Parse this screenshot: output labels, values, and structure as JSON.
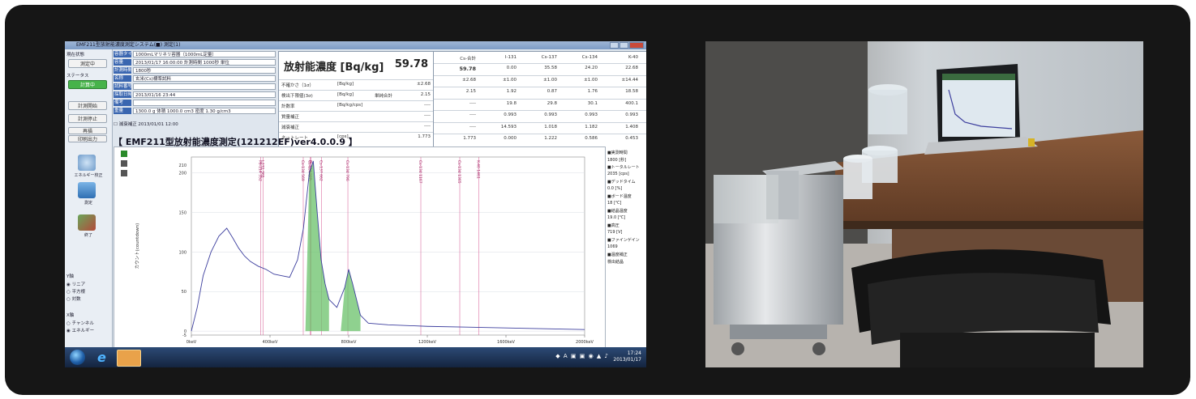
{
  "window": {
    "title": "EMF211型放射能濃度測定システム(■) 測定(1)"
  },
  "left_panel": {
    "status_label": "現在状態",
    "state_button": "測定中",
    "status_text": "ステータス",
    "mode_button": "計算中",
    "start_button": "計測開始",
    "stop_button": "計測停止",
    "display_button": "再描",
    "save_button": "印刷出力",
    "energy_calib_label": "エネルギー校正",
    "measure_label": "測定",
    "exit_label": "終了",
    "scale_title": "Y軸",
    "scale_options": [
      "リニア",
      "平方根",
      "対数"
    ],
    "scale_selected": "リニア",
    "xaxis_title": "X軸",
    "xaxis_options": [
      "チャンネル",
      "エネルギー"
    ],
    "xaxis_selected": "エネルギー"
  },
  "form": {
    "rows": [
      {
        "k": "容器タイプ",
        "v": "1000mLマリネリ容器（1000mL定量）"
      },
      {
        "k": "容量",
        "v": "2013/01/17 16:00:00 計測時間 1000秒 単位"
      },
      {
        "k": "計測時間",
        "v": "1800秒"
      },
      {
        "k": "名称",
        "v": "玄米(Cs)標準試料"
      },
      {
        "k": "試料番号",
        "v": ""
      },
      {
        "k": "採取日時",
        "v": "2013/01/16 23:44"
      },
      {
        "k": "備考",
        "v": ""
      },
      {
        "k": "重量",
        "v": "1300.0 g 体積 1000.0 cm3 密度 1.30 g/cm3"
      }
    ],
    "checkbox_label": "減衰補正 2013/01/01 12:00"
  },
  "result": {
    "title": "放射能濃度  [Bq/kg]",
    "value": "59.78",
    "rows": [
      {
        "label": "不確かさ（1σ）",
        "unit": "[Bq/kg]",
        "val": "±2.68"
      },
      {
        "label": "検出下限値(3σ)",
        "unit": "[Bq/kg]",
        "extra": "単純合計",
        "val": "2.15"
      },
      {
        "label": "計数率",
        "unit": "[Bq/kg/cps]",
        "val": "----"
      },
      {
        "label": "質量補正",
        "unit": "",
        "val": "----"
      },
      {
        "label": "減衰補正",
        "unit": "",
        "val": "----"
      },
      {
        "label": "ネットレート",
        "unit": "[cps]",
        "val": "1.773"
      }
    ]
  },
  "grid": {
    "headers": [
      "Cs-合計",
      "I-131",
      "Cs-137",
      "Cs-134",
      "K-40"
    ],
    "rows": [
      [
        "59.78",
        "0.00",
        "35.58",
        "24.20",
        "22.68"
      ],
      [
        "±2.68",
        "±1.00",
        "±1.00",
        "±1.00",
        "±14.44"
      ],
      [
        "2.15",
        "1.92",
        "0.87",
        "1.76",
        "18.58"
      ],
      [
        "----",
        "19.8",
        "29.8",
        "30.1",
        "400.1"
      ],
      [
        "----",
        "0.993",
        "0.993",
        "0.993",
        "0.993"
      ],
      [
        "----",
        "14.593",
        "1.018",
        "1.182",
        "1.408"
      ],
      [
        "1.773",
        "0.000",
        "1.222",
        "0.586",
        "0.453"
      ]
    ]
  },
  "chart_header": "【 EMF211型放射能濃度測定(121212EF)ver4.0.0.9 】",
  "chart_data": {
    "type": "line",
    "title": "",
    "xlabel": "エネルギー",
    "ylabel": "カウント(countdown)",
    "xlim": [
      0,
      2000
    ],
    "ylim": [
      -5,
      220
    ],
    "x_ticks": [
      "0keV",
      "400keV",
      "800keV",
      "1200keV",
      "1600keV",
      "2000keV"
    ],
    "y_ticks": [
      "-5",
      "0",
      "50",
      "100",
      "150",
      "200",
      "210"
    ],
    "marker_lines": [
      "K-40 1461",
      "Cs-137 662",
      "Cs-134 605",
      "Cs-134 796",
      "I-131 365",
      "Pb-214 352",
      "Bi-214 609",
      "Cs-134 569",
      "Cs-134 1365",
      "Cs-134 1167"
    ],
    "series": [
      {
        "values_x": [
          0,
          30,
          60,
          100,
          140,
          180,
          210,
          240,
          270,
          300,
          340,
          380,
          420,
          460,
          500,
          540,
          570,
          600,
          620,
          640,
          660,
          680,
          700,
          740,
          780,
          800,
          820,
          860,
          900,
          1000,
          1200,
          1400,
          1600,
          1800,
          2000
        ],
        "values_y": [
          0,
          30,
          70,
          100,
          120,
          130,
          118,
          105,
          95,
          88,
          82,
          78,
          72,
          70,
          68,
          90,
          130,
          200,
          215,
          150,
          90,
          60,
          40,
          30,
          55,
          78,
          60,
          20,
          10,
          8,
          6,
          5,
          4,
          3,
          2
        ]
      }
    ]
  },
  "legend_panel": [
    "■実測時間",
    "1800 [秒]",
    "■トータルレート",
    "2035 [cps]",
    "■デッドタイム",
    "0.0 [%]",
    "■ボード温度",
    "18 [℃]",
    "■結晶温度",
    "19.0 [℃]",
    "■高圧",
    "719 [V]",
    "■ファインゲイン",
    "1069",
    "■温度補正",
    "検出結晶"
  ],
  "taskbar": {
    "time": "17:24",
    "date": "2013/01/17"
  },
  "colors": {
    "accent": "#3a66b0",
    "spectrum": "#3d3f9e",
    "fill": "#6ac26a",
    "marker": "#d24a8a"
  }
}
